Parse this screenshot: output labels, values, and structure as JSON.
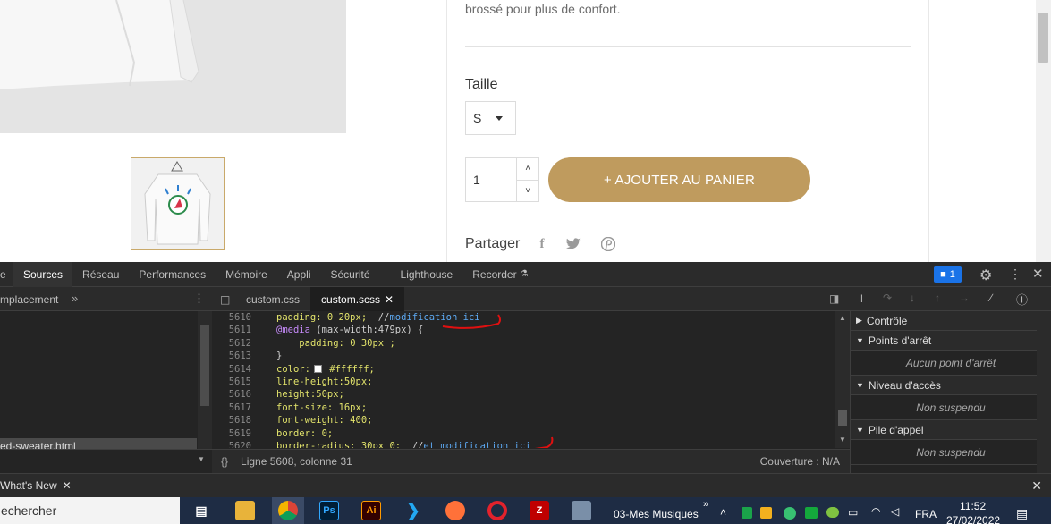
{
  "page": {
    "description_tail": "brossé pour plus de confort.",
    "size_label": "Taille",
    "size_selected": "S",
    "quantity_value": "1",
    "add_to_cart_label": "+  AJOUTER AU PANIER",
    "share_label": "Partager",
    "share_icons": [
      "facebook-icon",
      "twitter-icon",
      "pinterest-icon"
    ]
  },
  "devtools": {
    "tabs": [
      "e",
      "Sources",
      "Réseau",
      "Performances",
      "Mémoire",
      "Appli",
      "Sécurité",
      "Lighthouse",
      "Recorder"
    ],
    "active_tab": "Sources",
    "issues_count": "1",
    "navigator_label": "mplacement",
    "file_tabs": [
      "custom.css",
      "custom.scss"
    ],
    "active_file": "custom.scss",
    "navigator_selected_file": "ed-sweater.html",
    "line_numbers": [
      "5610",
      "5611",
      "5612",
      "5613",
      "5614",
      "5615",
      "5616",
      "5617",
      "5618",
      "5619",
      "5620"
    ],
    "code_lines": [
      {
        "prop": "padding:",
        "val": " 0 20px;",
        "rest": "  //",
        "cmt": "modification ici"
      },
      {
        "kw": "@media",
        "rest": " (max-width:479px) {"
      },
      {
        "indent": "    ",
        "prop": "padding:",
        "val": " 0 30px ;"
      },
      {
        "rest": "}"
      },
      {
        "prop": "color:",
        "val": " #ffffff;",
        "swatch": "#ffffff"
      },
      {
        "prop": "line-height:",
        "val": "50px;"
      },
      {
        "prop": "height:",
        "val": "50px;"
      },
      {
        "prop": "font-size:",
        "val": " 16px;"
      },
      {
        "prop": "font-weight:",
        "val": " 400;"
      },
      {
        "prop": "border:",
        "val": " 0;"
      },
      {
        "prop": "border-radius:",
        "val": " 30px 0;",
        "rest": "  //",
        "cmt": "et modification ici"
      }
    ],
    "status_position": "Ligne 5608, colonne 31",
    "status_coverage": "Couverture : N/A",
    "debugger_sections": [
      {
        "title": "Contrôle",
        "open": false,
        "body": ""
      },
      {
        "title": "Points d'arrêt",
        "open": true,
        "body": "Aucun point d'arrêt"
      },
      {
        "title": "Niveau d'accès",
        "open": true,
        "body": "Non suspendu"
      },
      {
        "title": "Pile d'appel",
        "open": true,
        "body": "Non suspendu"
      }
    ],
    "drawer_tab": "What's New",
    "annotation_color": "#e01010"
  },
  "taskbar": {
    "search_text": "echercher",
    "music_label": "03-Mes Musiques",
    "language": "FRA",
    "time": "11:52",
    "date": "27/02/2022"
  },
  "colors": {
    "accent_gold": "#bf9b5e",
    "devtools_bg": "#242424",
    "taskbar_bg": "#1e2c44"
  }
}
